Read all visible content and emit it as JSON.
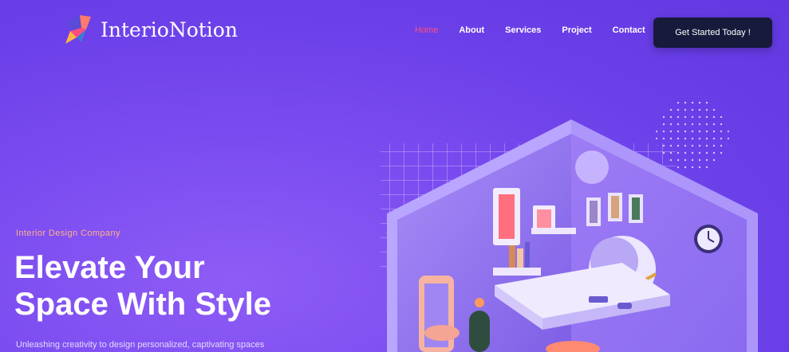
{
  "brand": {
    "name": "InterioNotion"
  },
  "nav": {
    "items": [
      {
        "label": "Home",
        "active": true
      },
      {
        "label": "About",
        "active": false
      },
      {
        "label": "Services",
        "active": false
      },
      {
        "label": "Project",
        "active": false
      },
      {
        "label": "Contact",
        "active": false
      }
    ],
    "active_color": "#ff4d7e"
  },
  "cta": {
    "label": "Get Started Today !"
  },
  "hero": {
    "eyebrow": "Interior Design Company",
    "headline_line1": "Elevate Your",
    "headline_line2": "Space With Style",
    "subtext": "Unleashing creativity to design personalized, captivating spaces"
  },
  "colors": {
    "background": "#7b4cf0",
    "eyebrow": "#ffb38a",
    "cta_background": "#171a3b"
  },
  "icons": [
    "logo-icon",
    "room-illustration"
  ]
}
